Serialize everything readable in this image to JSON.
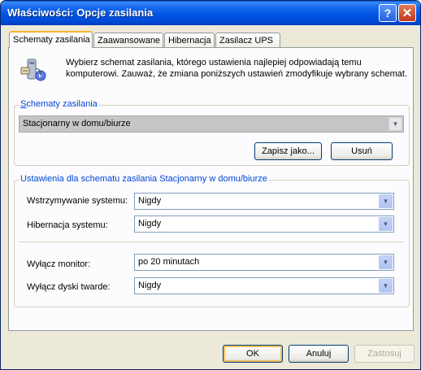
{
  "window": {
    "title": "Właściwości: Opcje zasilania",
    "help_glyph": "?",
    "close_glyph": "✕"
  },
  "tabs": [
    {
      "label": "Schematy zasilania",
      "active": true
    },
    {
      "label": "Zaawansowane",
      "active": false
    },
    {
      "label": "Hibernacja",
      "active": false
    },
    {
      "label": "Zasilacz UPS",
      "active": false
    }
  ],
  "intro": {
    "icon": "power-options-icon",
    "text": "Wybierz schemat zasilania, którego ustawienia najlepiej odpowiadają temu komputerowi. Zauważ, że zmiana poniższych ustawień zmodyfikuje wybrany schemat."
  },
  "schemes": {
    "group_label": "Schematy zasilania",
    "selected": "Stacjonarny w domu/biurze",
    "save_as": "Zapisz jako...",
    "delete": "Usuń"
  },
  "settings": {
    "group_label": "Ustawienia dla schematu zasilania Stacjonarny w domu/biurze",
    "rows": [
      {
        "label": "Wstrzymywanie systemu:",
        "value": "Nigdy"
      },
      {
        "label": "Hibernacja systemu:",
        "value": "Nigdy"
      },
      {
        "label": "Wyłącz monitor:",
        "value": "po 20 minutach"
      },
      {
        "label": "Wyłącz dyski twarde:",
        "value": "Nigdy"
      }
    ]
  },
  "footer": {
    "ok": "OK",
    "cancel": "Anuluj",
    "apply": "Zastosuj"
  }
}
